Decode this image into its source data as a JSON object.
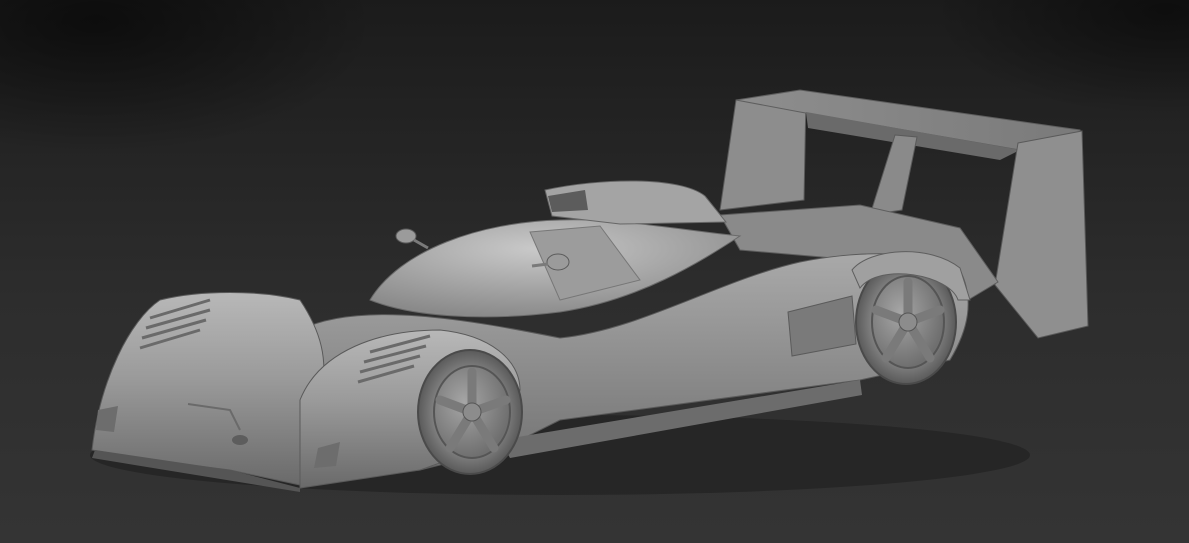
{
  "scene": {
    "subject": "race-car-3d-model",
    "colors": {
      "background_top": "#1b1b1b",
      "background_bottom": "#343434",
      "body": "#8f8f8f",
      "body_light": "#b4b4b4",
      "body_dark": "#5e5e5e",
      "shadow": "#3a3a3a"
    }
  }
}
